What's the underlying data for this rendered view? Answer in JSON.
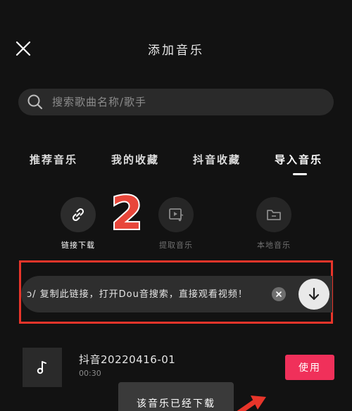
{
  "header": {
    "title": "添加音乐"
  },
  "search": {
    "placeholder": "搜索歌曲名称/歌手"
  },
  "tabs": [
    {
      "label": "推荐音乐"
    },
    {
      "label": "我的收藏"
    },
    {
      "label": "抖音收藏"
    },
    {
      "label": "导入音乐",
      "active": true
    }
  ],
  "sources": [
    {
      "label": "链接下载",
      "icon": "link-icon",
      "active": true
    },
    {
      "label": "提取音乐",
      "icon": "video-music-icon",
      "active": false
    },
    {
      "label": "本地音乐",
      "icon": "folder-icon",
      "active": false
    }
  ],
  "annotation": {
    "step_number": "2"
  },
  "link_input": {
    "value": "ɔ/ 复制此链接，打开Dou音搜索，直接观看视频！"
  },
  "track": {
    "title": "抖音20220416-01",
    "duration": "00:30",
    "use_label": "使用"
  },
  "toast": {
    "text": "该音乐已经下载"
  },
  "colors": {
    "background": "#121212",
    "annotation_red": "#e8352a",
    "use_button": "#f0305a"
  }
}
